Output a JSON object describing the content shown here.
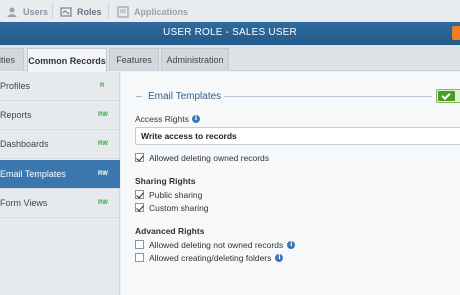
{
  "topbar": {
    "users_label": "Users",
    "roles_label": "Roles",
    "applications_label": "Applications"
  },
  "titlebar": {
    "title": "USER ROLE - SALES USER"
  },
  "tabs": [
    {
      "label": "ities",
      "active": false
    },
    {
      "label": "Common Records",
      "active": true
    },
    {
      "label": "Features",
      "active": false
    },
    {
      "label": "Administration",
      "active": false
    }
  ],
  "sidebar": {
    "items": [
      {
        "label": "Profiles",
        "perm": "R",
        "active": false
      },
      {
        "label": "Reports",
        "perm": "RW",
        "active": false
      },
      {
        "label": "Dashboards",
        "perm": "RW",
        "active": false
      },
      {
        "label": "Email Templates",
        "perm": "RW",
        "active": true
      },
      {
        "label": "Form Views",
        "perm": "RW",
        "active": false
      }
    ]
  },
  "main": {
    "section_title": "Email Templates",
    "enabled": true,
    "access_rights_label": "Access Rights",
    "access_rights_value": "Write access to records",
    "allowed_deleting_owned": {
      "label": "Allowed deleting owned records",
      "checked": true
    },
    "sharing_rights_title": "Sharing Rights",
    "public_sharing": {
      "label": "Public sharing",
      "checked": true
    },
    "custom_sharing": {
      "label": "Custom sharing",
      "checked": true
    },
    "advanced_rights_title": "Advanced Rights",
    "allowed_deleting_not_owned": {
      "label": "Allowed deleting not owned records",
      "checked": false
    },
    "allowed_creating_folders": {
      "label": "Allowed creating/deleting folders",
      "checked": false
    }
  },
  "colors": {
    "accent": "#3b76ad",
    "titlebar": "#2f6b9e",
    "permission_green": "#3bab3f",
    "toggle_green": "#4c9a2a"
  }
}
